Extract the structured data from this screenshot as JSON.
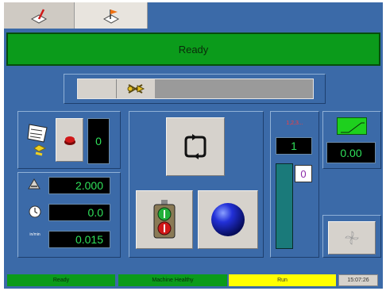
{
  "tabs": [
    {
      "name": "setup-tab",
      "icon": "pen-tool-icon"
    },
    {
      "name": "run-tab",
      "icon": "flag-tool-icon"
    }
  ],
  "status_title": "Ready",
  "left_panel": {
    "counter_value": "0",
    "rows": [
      {
        "icon": "thickness-icon",
        "value": "2.000"
      },
      {
        "icon": "clock-icon",
        "value": "0.0"
      },
      {
        "icon": "speed-icon",
        "label": "in/min",
        "value": "0.015"
      }
    ]
  },
  "center_panel": {
    "cycle_icon": "cycle-loop-icon",
    "stoplight_icon": "stoplight-icon",
    "ball_icon": "blue-ball-icon"
  },
  "right_panel": {
    "header": "1,2,3...",
    "count_value": "1",
    "level_value": "0",
    "readout_value": "0.00",
    "graph_icon": "ramp-graph-icon",
    "fan_icon": "fan-icon"
  },
  "status_bar": {
    "state": "Ready",
    "health": "Machine Healthy",
    "mode": "Run",
    "time": "15:07:26"
  },
  "colors": {
    "background": "#3b6aa8",
    "ready_green": "#0b9b1b",
    "digit_green": "#2fe05a",
    "status_yellow": "#ffff00"
  }
}
